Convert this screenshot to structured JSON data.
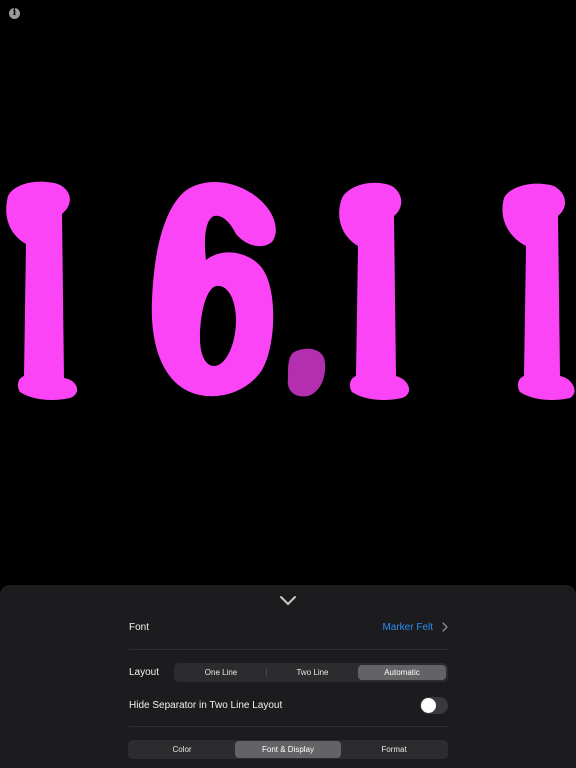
{
  "clock": {
    "time_text": "16.11",
    "digit_color": "#fb44f5",
    "separator_color": "#b42fb0",
    "background_color": "#000000"
  },
  "info_button": {
    "icon": "info-icon",
    "glyph": "i"
  },
  "settings_panel": {
    "collapse_icon": "chevron-down-icon",
    "font": {
      "label": "Font",
      "value": "Marker Felt",
      "value_color": "#2a8cf5"
    },
    "layout": {
      "label": "Layout",
      "options": [
        "One Line",
        "Two Line",
        "Automatic"
      ],
      "selected": "Automatic"
    },
    "hide_separator": {
      "label": "Hide Separator in Two Line Layout",
      "enabled": false
    },
    "tabs": {
      "options": [
        "Color",
        "Font & Display",
        "Format"
      ],
      "selected": "Font & Display"
    }
  }
}
